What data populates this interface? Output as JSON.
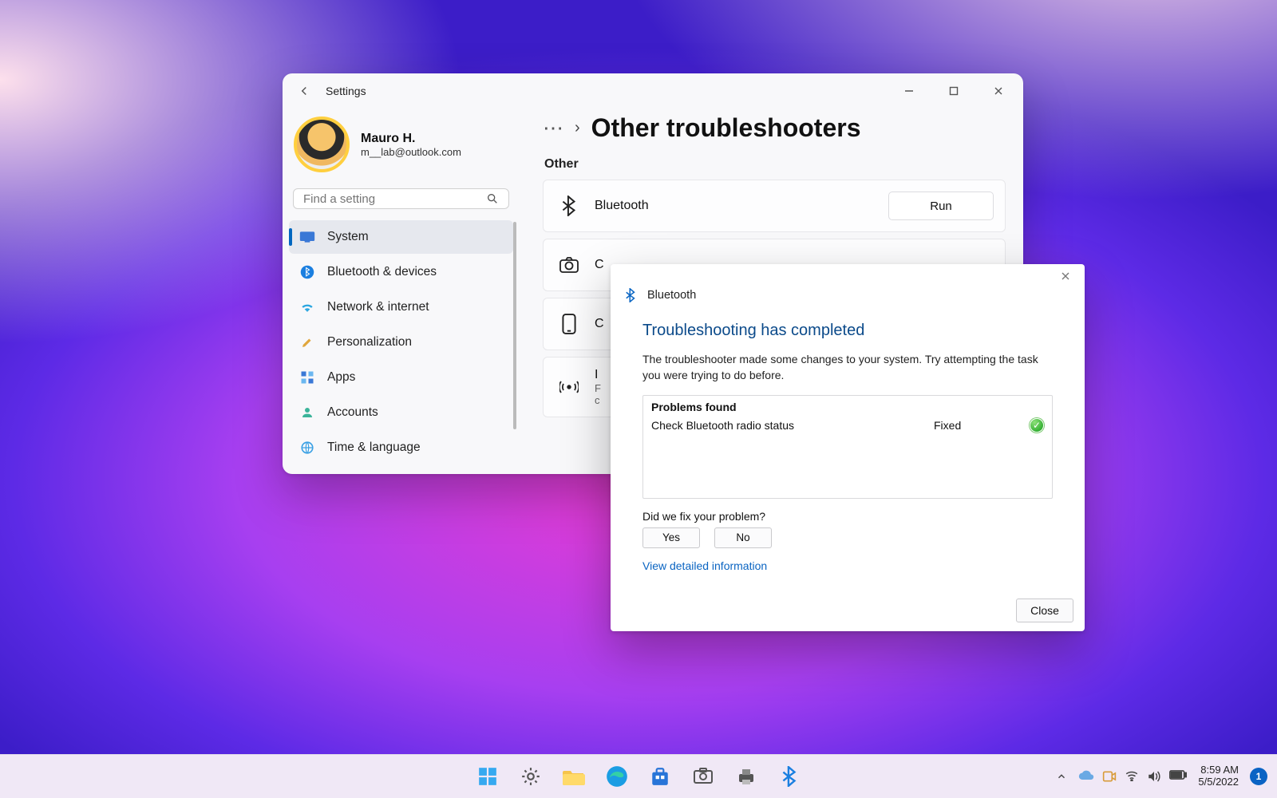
{
  "window": {
    "title": "Settings",
    "account": {
      "name": "Mauro H.",
      "email": "m__lab@outlook.com"
    },
    "search_placeholder": "Find a setting",
    "nav": {
      "items": [
        {
          "label": "System"
        },
        {
          "label": "Bluetooth & devices"
        },
        {
          "label": "Network & internet"
        },
        {
          "label": "Personalization"
        },
        {
          "label": "Apps"
        },
        {
          "label": "Accounts"
        },
        {
          "label": "Time & language"
        }
      ]
    },
    "page": {
      "title": "Other troubleshooters",
      "section": "Other",
      "cards": [
        {
          "label": "Bluetooth",
          "run": "Run"
        },
        {
          "label": "C"
        },
        {
          "label": "C"
        },
        {
          "label": "I",
          "sub1": "F",
          "sub2": "c"
        }
      ]
    }
  },
  "troubleshooter": {
    "name": "Bluetooth",
    "heading": "Troubleshooting has completed",
    "description": "The troubleshooter made some changes to your system. Try attempting the task you were trying to do before.",
    "problems_header": "Problems found",
    "problems": [
      {
        "issue": "Check Bluetooth radio status",
        "status": "Fixed"
      }
    ],
    "feedback_q": "Did we fix your problem?",
    "yes": "Yes",
    "no": "No",
    "view_more": "View detailed information",
    "close": "Close"
  },
  "taskbar": {
    "time": "8:59 AM",
    "date": "5/5/2022",
    "notif_count": "1"
  }
}
